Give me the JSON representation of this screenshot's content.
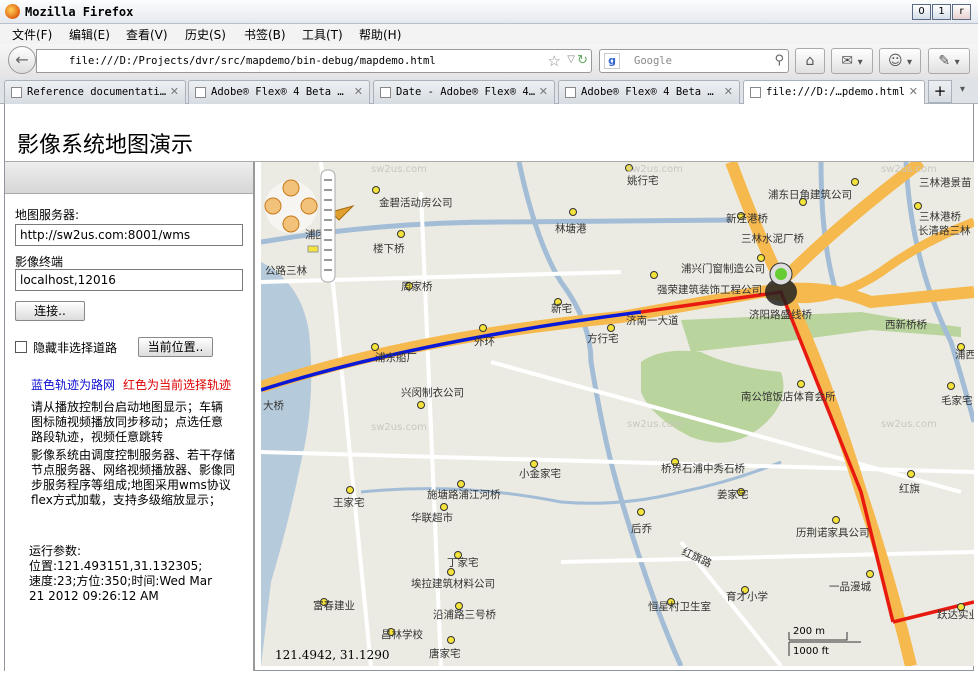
{
  "window": {
    "title": "Mozilla Firefox",
    "min": "0",
    "max": "1",
    "close": "r"
  },
  "menu": [
    "文件(F)",
    "编辑(E)",
    "查看(V)",
    "历史(S)",
    "书签(B)",
    "工具(T)",
    "帮助(H)"
  ],
  "nav": {
    "back_glyph": "←",
    "url": "file:///D:/Projects/dvr/src/mapdemo/bin-debug/mapdemo.html",
    "star_glyph": "☆",
    "dropdown_glyph": "▽",
    "reload_glyph": "↻",
    "search_engine_glyph": "g",
    "search_placeholder": "Google",
    "search_glyph": "⚲",
    "home_glyph": "⌂",
    "ext1_glyph": "✉",
    "ext2_glyph": "☺",
    "ext3_glyph": "✎",
    "menu_arrow": "▾"
  },
  "tabs": [
    {
      "label": "Reference documentati…",
      "close": "✕"
    },
    {
      "label": "Adobe® Flex® 4 Beta …",
      "close": "✕"
    },
    {
      "label": "Date - Adobe® Flex® 4…",
      "close": "✕"
    },
    {
      "label": "Adobe® Flex® 4 Beta …",
      "close": "✕"
    },
    {
      "label": "file:///D:/…pdemo.html",
      "close": "✕"
    }
  ],
  "tabs_extra": {
    "new_tab": "+",
    "list": "▾"
  },
  "page": {
    "heading": "影像系统地图演示",
    "server_label": "地图服务器:",
    "server_value": "http://sw2us.com:8001/wms",
    "terminal_label": "影像终端",
    "terminal_value": "localhost,12016",
    "connect_button": "连接..",
    "hide_label": "隐藏非选择道路",
    "current_pos_button": "当前位置..",
    "legend_blue": "蓝色轨迹为路网",
    "legend_red": "红色为当前选择轨迹",
    "info1": "请从播放控制台启动地图显示；车辆图标随视频播放同步移动；点选任意路段轨迹，视频任意跳转",
    "info2": "影像系统由调度控制服务器、若干存储节点服务器、网络视频播放器、影像同步服务程序等组成;地图采用wms协议flex方式加载，支持多级缩放显示；",
    "params_title": "运行参数:",
    "params_text": "位置:121.493151,31.132305;速度:23;方位:350;时间:Wed Mar 21 2012 09:26:12 AM"
  },
  "map": {
    "coord_readout": "121.4942, 31.1290",
    "scale_metric": "200 m",
    "scale_imperial": "1000 ft",
    "watermark": "sw2us.com",
    "colors": {
      "road_major": "#f7b54a",
      "route_blue": "#0a18d8",
      "route_red": "#e81a10",
      "water": "#b5cadb",
      "park": "#b9d49d"
    },
    "labels": [
      "姚行宅",
      "金碧活动房公司",
      "浦东日角建筑公司",
      "三林港景苗",
      "新泾港桥",
      "三林港桥",
      "林塘港",
      "长清路三林",
      "三林水泥厂桥",
      "楼下桥",
      "周家桥",
      "公路三林",
      "浦兴门窗制造公司",
      "强荣建筑装饰工程公司",
      "西新桥桥",
      "新宅",
      "济阳路盛线桥",
      "外环",
      "方行宅",
      "浦东船厂",
      "济南一大道",
      "浦西",
      "兴闵制衣公司",
      "南公馆饭店体育会所",
      "毛家宅",
      "大桥",
      "小金家宅",
      "桥界石浦中秀石桥",
      "王家宅",
      "施塘路浦江河桥",
      "姜家宅",
      "红旗",
      "华联超市",
      "后乔",
      "历荆诺家具公司",
      "丁家宅",
      "红旗路",
      "埃拉建筑材料公司",
      "富春建业",
      "恒星村卫生室",
      "育才小学",
      "一品漫城",
      "沿浦路三号桥",
      "昌林学校",
      "唐家宅",
      "跃达实业",
      "浦团"
    ]
  }
}
